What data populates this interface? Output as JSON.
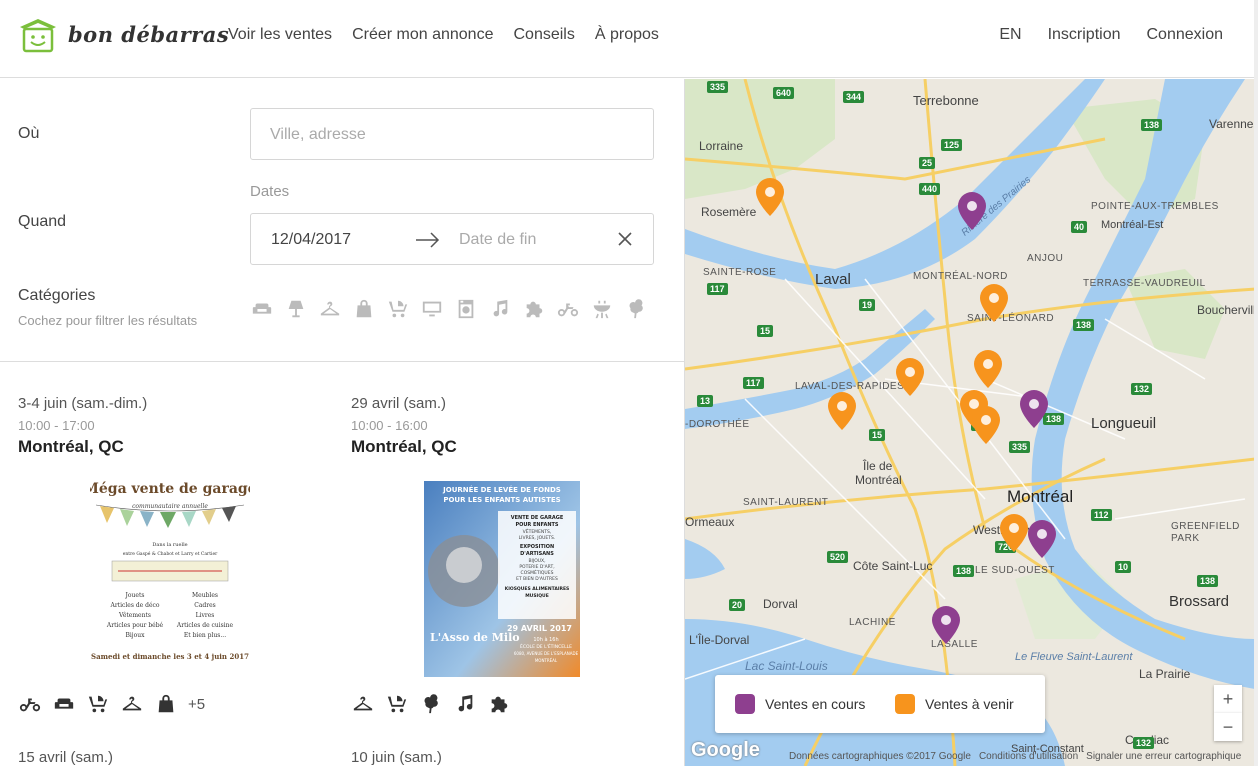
{
  "header": {
    "brand": "bon débarras",
    "nav_left": [
      "Voir les ventes",
      "Créer mon annonce",
      "Conseils",
      "À propos"
    ],
    "nav_right": [
      "EN",
      "Inscription",
      "Connexion"
    ]
  },
  "search": {
    "where_label": "Où",
    "where_placeholder": "Ville, adresse",
    "when_label": "Quand",
    "dates_label": "Dates",
    "start_date": "12/04/2017",
    "end_placeholder": "Date de fin",
    "categories_label": "Catégories",
    "categories_hint": "Cochez pour filtrer les résultats",
    "category_icons": [
      "sofa-icon",
      "lamp-icon",
      "hanger-icon",
      "bag-icon",
      "stroller-icon",
      "monitor-icon",
      "washer-icon",
      "music-note-icon",
      "puzzle-icon",
      "bicycle-icon",
      "bbq-icon",
      "clover-icon"
    ]
  },
  "listings": [
    {
      "date": "3-4 juin (sam.-dim.)",
      "time": "10:00 - 17:00",
      "city": "Montréal, QC",
      "poster": {
        "title": "Méga vente de garage",
        "subtitle": "communautaire annuelle",
        "line1": "Dans la ruelle",
        "line2": "entre Gaspé & Chabot et Larry et Cartier",
        "col1": [
          "Jouets",
          "Articles de déco",
          "Vêtements",
          "Articles pour bébé",
          "Bijoux"
        ],
        "col2": [
          "Meubles",
          "Cadres",
          "Livres",
          "Articles de cuisine",
          "Et bien plus..."
        ],
        "footer": "Samedi et dimanche les 3 et 4 juin 2017"
      },
      "tags": [
        "bicycle-icon",
        "sofa-icon",
        "stroller-icon",
        "hanger-icon",
        "bag-icon"
      ],
      "more": "+5"
    },
    {
      "date": "29 avril (sam.)",
      "time": "10:00 - 16:00",
      "city": "Montréal, QC",
      "poster": {
        "head1": "JOURNÉE DE LEVÉE DE FONDS",
        "head2": "POUR LES ENFANTS AUTISTES",
        "b1": "VENTE DE GARAGE",
        "b2": "POUR ENFANTS",
        "b3": "VÊTEMENTS,",
        "b4": "LIVRES, JOUETS.",
        "b5": "EXPOSITION",
        "b6": "D'ARTISANS",
        "b7": "BIJOUX,",
        "b8": "POTERIE D'ART,",
        "b9": "COSMÉTIQUES",
        "b10": "ET BIEN D'AUTRES",
        "b11": "KIOSQUES ALIMENTAIRES",
        "b12": "MUSIQUE",
        "brand": "L'Asso de Milo",
        "date": "29 AVRIL 2017",
        "hours": "10h à 16h",
        "place": "ÉCOLE DE L'ÉTINCELLE",
        "addr": "6080, AVENUE DE L'ESPLANADE",
        "town": "MONTRÉAL"
      },
      "tags": [
        "hanger-icon",
        "stroller-icon",
        "clover-icon",
        "music-note-icon",
        "puzzle-icon"
      ]
    }
  ],
  "next_dates": [
    "15 avril (sam.)",
    "10 juin (sam.)"
  ],
  "map": {
    "labels": {
      "terrebonne": "Terrebonne",
      "lorraine": "Lorraine",
      "rosemere": "Rosemère",
      "laval": "Laval",
      "sainte_rose": "SAINTE-ROSE",
      "montreal_nord": "MONTRÉAL-NORD",
      "anjou": "ANJOU",
      "pointe": "POINTE-AUX-TREMBLES",
      "montreal_est": "Montréal-Est",
      "varennes": "Varennes",
      "terrasse": "TERRASSE-VAUDREUIL",
      "boucherville": "Boucherville",
      "saint_leonard": "SAINT-LÉONARD",
      "laval_rapides": "LAVAL-DES-RAPIDES",
      "dorothee": "-DOROTHÉE",
      "longueuil": "Longueuil",
      "ile_mtl": "Île de",
      "ile_mtl2": "Montréal",
      "montreal": "Montréal",
      "saint_laurent": "SAINT-LAURENT",
      "ormeaux": "Ormeaux",
      "westmount": "Westmount",
      "cote": "Côte Saint-Luc",
      "sud_ouest": "LE SUD-OUEST",
      "greenfield": "GREENFIELD",
      "park": "PARK",
      "dorval": "Dorval",
      "lachine": "LACHINE",
      "lasalle": "LASALLE",
      "brossard": "Brossard",
      "ile_dorval": "L'Île-Dorval",
      "lac": "Lac Saint-Louis",
      "fleuve": "Le Fleuve Saint-Laurent",
      "candiac": "Candiac",
      "la_prairie": "La Prairie",
      "saint_constant": "Saint-Constant",
      "riviere": "Rivière des Prairies"
    },
    "legend": {
      "current": "Ventes en cours",
      "upcoming": "Ventes à venir",
      "current_color": "#8e3f8f",
      "upcoming_color": "#f7941d"
    },
    "zoom_in": "+",
    "zoom_out": "−",
    "google": "Google",
    "attribution": [
      "Données cartographiques ©2017 Google",
      "Conditions d'utilisation",
      "Signaler une erreur cartographique"
    ],
    "shields": [
      "335",
      "640",
      "344",
      "117",
      "25",
      "125",
      "440",
      "138",
      "40",
      "15",
      "19",
      "13",
      "520",
      "138",
      "20",
      "720",
      "10",
      "132",
      "112",
      "15",
      "125",
      "138",
      "335",
      "20",
      "138",
      "132",
      "138",
      "117"
    ]
  }
}
